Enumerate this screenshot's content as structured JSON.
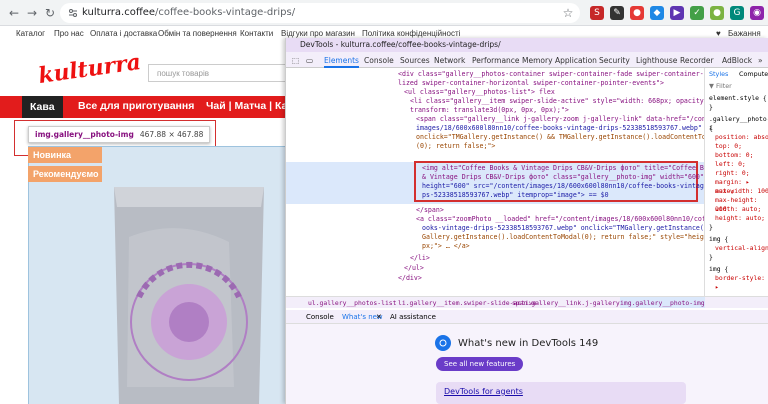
{
  "browser": {
    "url_domain": "kulturra.coffee",
    "url_path": "/coffee-books-vintage-drips/",
    "back_icon": "arrow-left-icon",
    "forward_icon": "arrow-right-icon",
    "reload_icon": "reload-icon"
  },
  "site": {
    "topnav": [
      "Каталог",
      "Про нас",
      "Оплата і доставка",
      "Обмін та повернення",
      "Контакти",
      "Відгуки про магазин",
      "Політика конфіденційності"
    ],
    "wishlist": "Бажання",
    "logo": "kulturra",
    "search_placeholder": "пошук товарів",
    "categories": [
      "Кава",
      "Все для приготування",
      "Чай | Матча | Как"
    ],
    "tooltip_name": "img.gallery__photo-img",
    "tooltip_dims": "467.88 × 467.88",
    "badges": [
      "Новинка",
      "Рекомендуємо"
    ],
    "colors": {
      "brand_red": "#e21c1c",
      "badge_orange": "#f3a36a"
    }
  },
  "devtools": {
    "title": "DevTools - kulturra.coffee/coffee-books-vintage-drips/",
    "tabs": [
      "Elements",
      "Console",
      "Sources",
      "Network",
      "Performance",
      "Memory",
      "Application",
      "Security",
      "Lighthouse",
      "Recorder",
      "AdBlock"
    ],
    "code_lines": [
      "<div class=\"gallery__photos-container swiper-container-fade swiper-container-initia",
      "lized swiper-container-horizontal swiper-container-pointer-events\">",
      "<ul class=\"gallery__photos-list\"> flex",
      "<li class=\"gallery__item swiper-slide-active\" style=\"width: 668px; opacity: 1;",
      "transform: translate3d(0px, 0px, 0px);\">",
      "<span class=\"gallery__link j-gallery-zoom j-gallery-link\" data-href=\"/content/",
      "images/18/600x600l80nn10/coffee-books-vintage-drips-52338518593767.webp\"",
      "onclick=\"TMGallery.getInstance() && TMGallery.getInstance().loadContentToModal",
      "(0); return false;\">",
      "<img alt=\"Coffee Books & Vintage Drips CB&V-Drips фото\" title=\"Coffee Books",
      "& Vintage Drips CB&V-Drips фото\" class=\"gallery__photo-img\" width=\"600\"",
      "height=\"600\" src=\"/content/images/18/600x600l80nn10/coffee-books-vintage-dri",
      "ps-52338518593767.webp\" itemprop=\"image\"> == $0",
      "</span>",
      "<a class=\"zoomPhoto __loaded\" href=\"/content/images/18/600x600l80nn10/coffee-b",
      "ooks-vintage-drips-52338518593767.webp\" onclick=\"TMGallery.getInstance() && TM",
      "Gallery.getInstance().loadContentToModal(0); return false;\" style=\"height: 668",
      "px;\"> … </a>",
      "</li>",
      "</ul>",
      "</div>"
    ],
    "styles_tabs": [
      "Styles",
      "Computed"
    ],
    "styles_filter": "Filter",
    "styles_lines": [
      "element.style {",
      "}",
      ".gallery__photo-i",
      "{",
      "position: abso",
      "top: 0;",
      "bottom: 0;",
      "left: 0;",
      "right: 0;",
      "margin: ▸ auto;",
      "max-width: 100",
      "max-height: 100",
      "width: auto;",
      "height: auto;",
      "}",
      "img {",
      "vertical-align",
      "}",
      "img {",
      "border-style: ▸"
    ],
    "crumbs": [
      "ul.gallery__photos-list",
      "li.gallery__item.swiper-slide-active",
      "span.gallery__link.j-gallery-zoom.j-gallery-link",
      "img.gallery__photo-img"
    ],
    "drawer_tabs": [
      "Console",
      "What's new",
      "AI assistance"
    ],
    "whats_new_title": "What's new in DevTools 149",
    "see_all": "See all new features",
    "agents_link": "DevTools for agents"
  }
}
